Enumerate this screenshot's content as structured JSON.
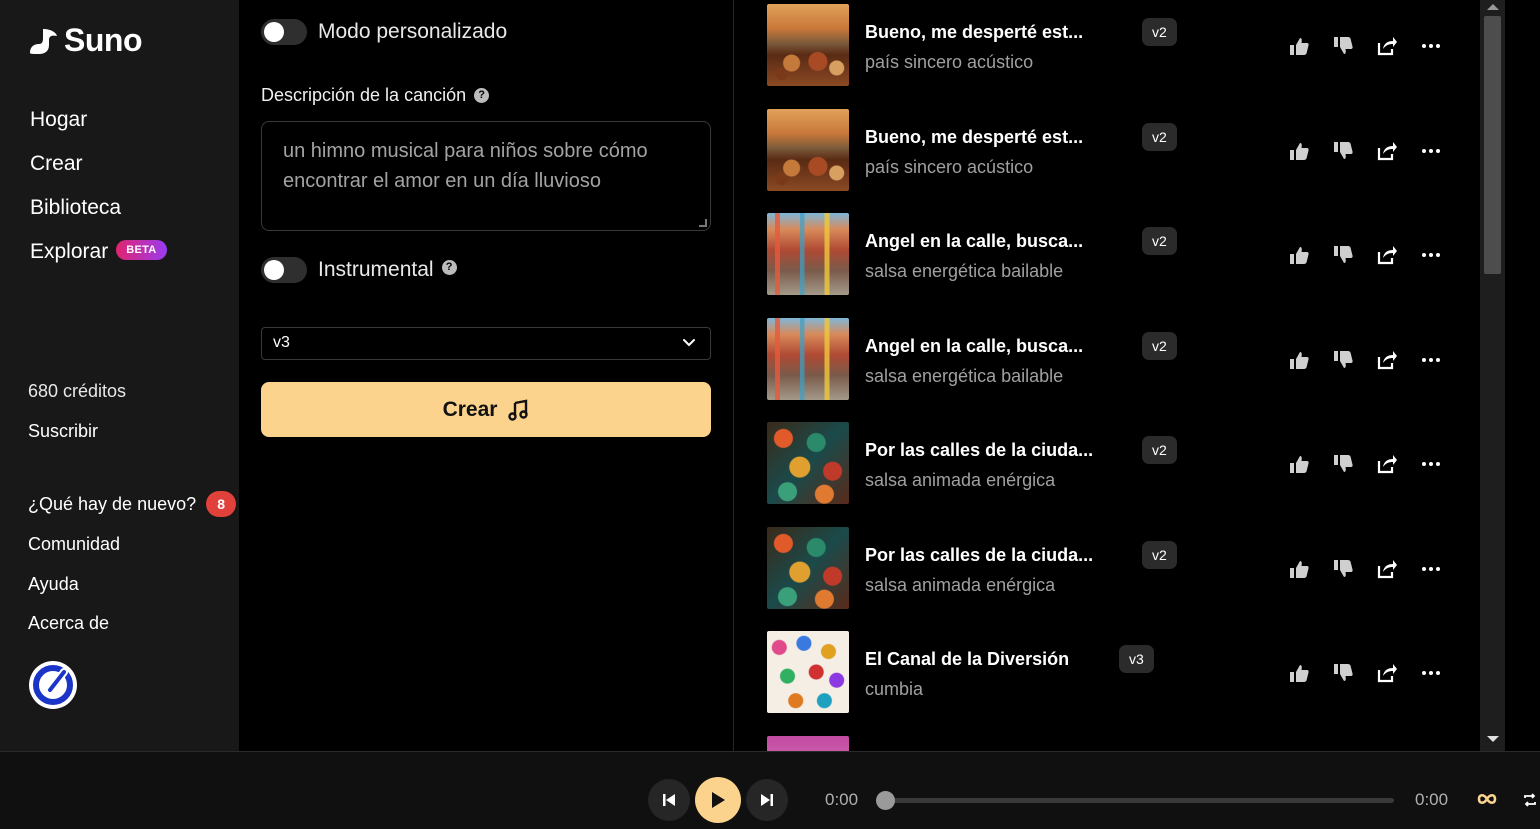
{
  "brand": {
    "name": "Suno"
  },
  "sidebar": {
    "nav": [
      {
        "label": "Hogar"
      },
      {
        "label": "Crear"
      },
      {
        "label": "Biblioteca"
      },
      {
        "label": "Explorar",
        "badge": "BETA"
      }
    ],
    "credits": "680 créditos",
    "subscribe": "Suscribir",
    "whats_new": {
      "label": "¿Qué hay de nuevo?",
      "count": "8"
    },
    "community": "Comunidad",
    "help": "Ayuda",
    "about": "Acerca de"
  },
  "form": {
    "custom_mode_label": "Modo personalizado",
    "custom_mode_on": false,
    "description_label": "Descripción de la canción",
    "description_placeholder": "un himno musical para niños sobre cómo encontrar el amor en un día lluvioso",
    "instrumental_label": "Instrumental",
    "instrumental_on": false,
    "model_selected": "v3",
    "create_label": "Crear"
  },
  "songs": [
    {
      "title": "Bueno, me desperté est...",
      "tags": "país sincero acústico",
      "version": "v2",
      "art": "feast"
    },
    {
      "title": "Bueno, me desperté est...",
      "tags": "país sincero acústico",
      "version": "v2",
      "art": "feast"
    },
    {
      "title": "Angel en la calle, busca...",
      "tags": "salsa energética bailable",
      "version": "v2",
      "art": "street"
    },
    {
      "title": "Angel en la calle, busca...",
      "tags": "salsa energética bailable",
      "version": "v2",
      "art": "street"
    },
    {
      "title": "Por las calles de la ciuda...",
      "tags": "salsa animada enérgica",
      "version": "v2",
      "art": "food"
    },
    {
      "title": "Por las calles de la ciuda...",
      "tags": "salsa animada enérgica",
      "version": "v2",
      "art": "food"
    },
    {
      "title": "El Canal de la Diversión",
      "tags": "cumbia",
      "version": "v3",
      "art": "dance"
    }
  ],
  "player": {
    "current_time": "0:00",
    "duration": "0:00",
    "progress": 0
  },
  "colors": {
    "accent": "#fbd38d",
    "sidebar_bg": "#181818",
    "badge_red": "#e0413b"
  }
}
